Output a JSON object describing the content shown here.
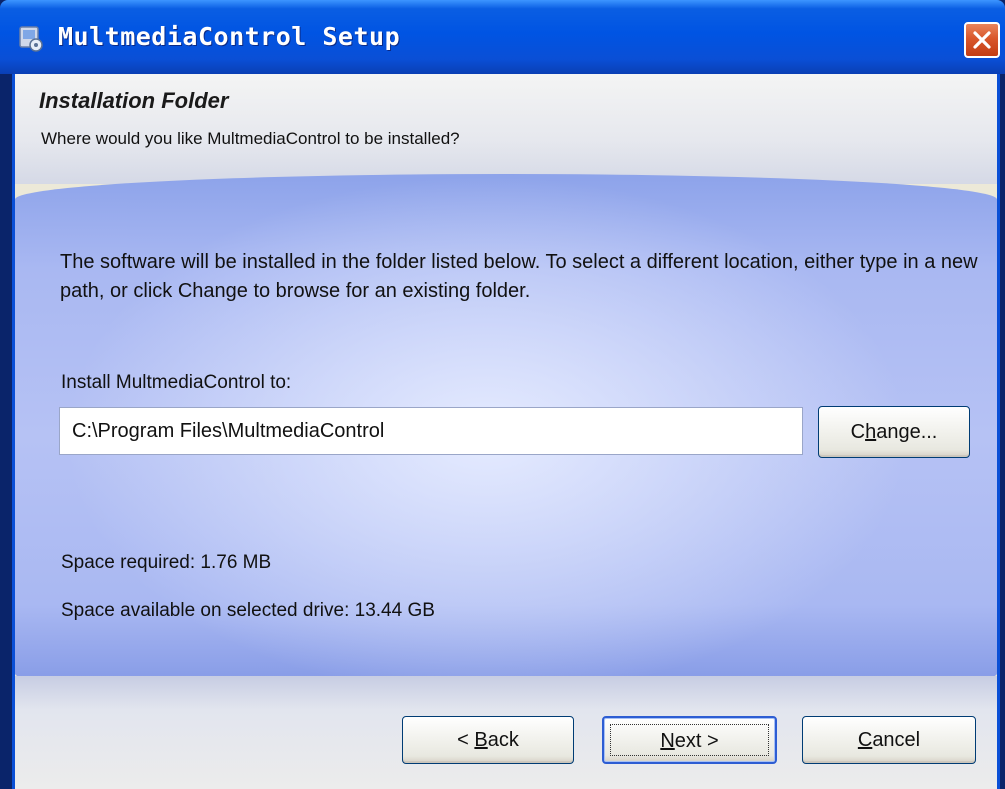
{
  "window": {
    "title": "MultmediaControl Setup"
  },
  "header": {
    "title": "Installation Folder",
    "subtitle": "Where would you like MultmediaControl to be installed?"
  },
  "main": {
    "description": "The software will be installed in the folder listed below. To select a different location, either type in a new path, or click Change to browse for an existing folder.",
    "install_label": "Install MultmediaControl to:",
    "install_path": "C:\\Program Files\\MultmediaControl",
    "change_button": {
      "pre": "C",
      "accel": "h",
      "post": "ange..."
    },
    "space_required": "Space required: 1.76 MB",
    "space_available": "Space available on selected drive: 13.44 GB"
  },
  "footer": {
    "back_button": {
      "pre": "< ",
      "accel": "B",
      "post": "ack"
    },
    "next_button": {
      "pre": "",
      "accel": "N",
      "post": "ext >"
    },
    "cancel_button": {
      "pre": "",
      "accel": "C",
      "post": "ancel"
    }
  },
  "icons": {
    "app": "setup-app-icon",
    "close": "close-icon"
  },
  "colors": {
    "titlebar": "#0054e3",
    "close_button": "#d9572b",
    "panel": "#b6c2f4",
    "dialog_face": "#ece9d8"
  }
}
